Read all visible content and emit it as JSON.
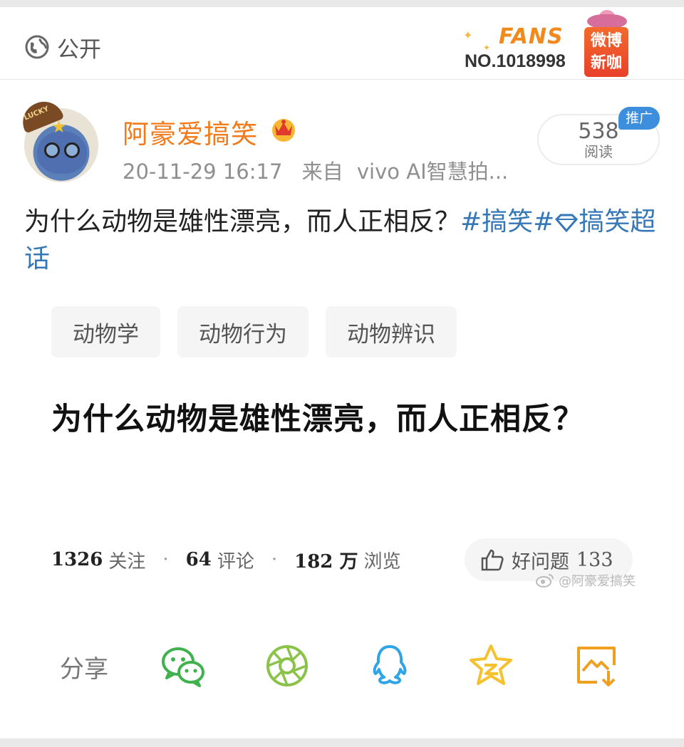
{
  "header": {
    "visibility_label": "公开",
    "fans_badge": {
      "word": "FANS",
      "number": "NO.1018998",
      "brand_line1": "微博",
      "brand_line2": "新咖"
    }
  },
  "author": {
    "name": "阿豪爱搞笑",
    "time": "20-11-29 16:17",
    "source_prefix": "来自",
    "device": "vivo AI智慧拍...",
    "avatar_cap_text": "LUCKY"
  },
  "reads": {
    "count": "538",
    "label": "阅读",
    "promo": "推广"
  },
  "post": {
    "text": "为什么动物是雄性漂亮，而人正相反？",
    "hashtag": "#搞笑#",
    "supertopic": "搞笑超话"
  },
  "card": {
    "chips": [
      "动物学",
      "动物行为",
      "动物辨识"
    ],
    "title": "为什么动物是雄性漂亮，而人正相反？",
    "stats": {
      "follow_count": "1326",
      "follow_label": "关注",
      "comment_count": "64",
      "comment_label": "评论",
      "view_count": "182 万",
      "view_label": "浏览",
      "separator": "·"
    },
    "good_question_label": "好问题",
    "good_question_count": "133",
    "watermark": "@阿豪爱搞笑"
  },
  "share": {
    "label": "分享",
    "icons": [
      "wechat-icon",
      "moments-icon",
      "qq-icon",
      "qzone-icon",
      "save-image-icon"
    ]
  },
  "colors": {
    "author_name": "#f27a1a",
    "hashtag": "#3677b8",
    "wechat": "#3fb24d",
    "moments": "#8bc34a",
    "qq": "#2fa4e7",
    "qzone": "#f5c12e",
    "save": "#f0a020"
  }
}
